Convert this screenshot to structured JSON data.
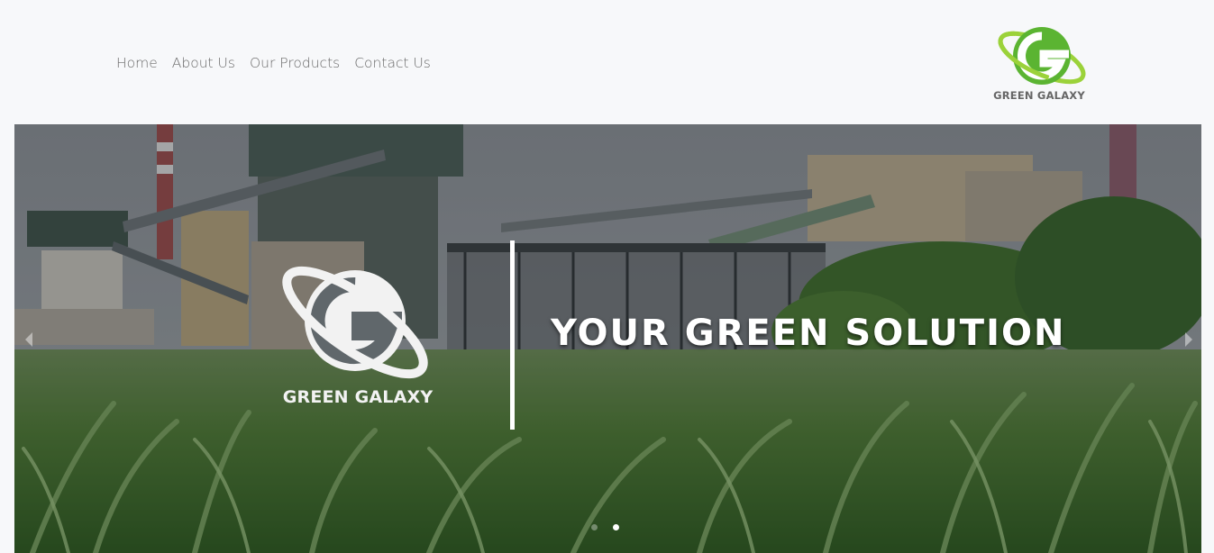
{
  "nav": {
    "items": [
      {
        "label": "Home"
      },
      {
        "label": "About Us"
      },
      {
        "label": "Our Products"
      },
      {
        "label": "Contact Us"
      }
    ]
  },
  "logo": {
    "text": "GREEN GALAXY",
    "icon": "green-galaxy-logo-icon",
    "colors": {
      "primary": "#5bb432",
      "ring": "#9bd23a"
    }
  },
  "hero": {
    "logo_text": "GREEN GALAXY",
    "headline": "YOUR GREEN SOLUTION",
    "slides_count": 2,
    "active_slide": 2,
    "prev_icon": "chevron-left-icon",
    "next_icon": "chevron-right-icon"
  }
}
